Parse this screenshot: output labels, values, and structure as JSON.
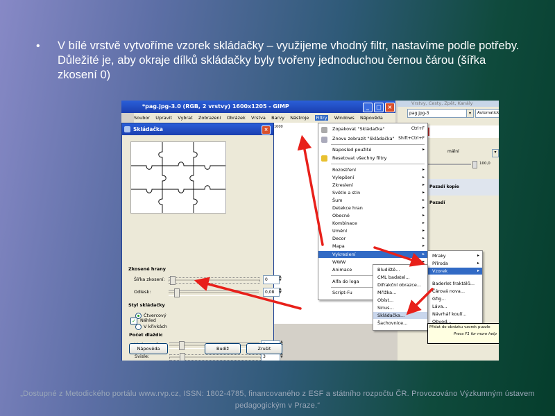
{
  "slide": {
    "bullet": "•",
    "text": "V bílé vrstvě vytvoříme vzorek skládačky – využijeme vhodný filtr, nastavíme podle potřeby. Důležité je, aby okraje dílků skládačky byly tvořeny jednoduchou černou čárou (šířka zkosení 0)",
    "footer": "„Dostupné z Metodického portálu www.rvp.cz, ISSN: 1802-4785, financovaného z ESF a státního rozpočtu ČR. Provozováno Výzkumným ústavem pedagogickým v Praze.“"
  },
  "gimp": {
    "title": "*pag.jpg-3.0 (RGB, 2 vrstvy) 1600x1205 - GIMP",
    "menu": [
      "Soubor",
      "Upravit",
      "Vybrat",
      "Zobrazení",
      "Obrázek",
      "Vrstva",
      "Barvy",
      "Nástroje",
      "Filtry",
      "Windows",
      "Nápověda"
    ],
    "active_menu": "Filtry",
    "ruler": "1000"
  },
  "dock": {
    "title": "Vrstvy, Cesty, Zpět, Kanály",
    "image": "pag.jpg-3",
    "auto": "Automaticky",
    "mode": "mální",
    "opacity": "100,0",
    "layers": [
      {
        "name": "Pozadí kopie"
      },
      {
        "name": "Pozadí"
      }
    ]
  },
  "filters_menu": {
    "items": [
      {
        "label": "Zopakovat \"Skládačka\"",
        "shortcut": "Ctrl+F"
      },
      {
        "label": "Znovu zobrazit \"Skládačka\"",
        "shortcut": "Shift+Ctrl+F"
      },
      {
        "label": "Naposled použité",
        "arrow": true
      },
      {
        "label": "Resetovat všechny filtry"
      },
      {
        "label": "Rozostření",
        "arrow": true
      },
      {
        "label": "Vylepšení",
        "arrow": true
      },
      {
        "label": "Zkreslení",
        "arrow": true
      },
      {
        "label": "Světlo a stín",
        "arrow": true
      },
      {
        "label": "Šum",
        "arrow": true
      },
      {
        "label": "Detekce hran",
        "arrow": true
      },
      {
        "label": "Obecné",
        "arrow": true
      },
      {
        "label": "Kombinace",
        "arrow": true
      },
      {
        "label": "Umění",
        "arrow": true
      },
      {
        "label": "Decor",
        "arrow": true
      },
      {
        "label": "Mapa",
        "arrow": true
      },
      {
        "label": "Vykreslení",
        "arrow": true,
        "highlighted": true
      },
      {
        "label": "WWW",
        "arrow": true
      },
      {
        "label": "Animace",
        "arrow": true
      },
      {
        "label": "Alfa do loga",
        "arrow": true
      },
      {
        "label": "Script-Fu",
        "arrow": true
      }
    ]
  },
  "render_submenu": {
    "items": [
      {
        "label": "Mraky",
        "arrow": true
      },
      {
        "label": "Příroda",
        "arrow": true
      },
      {
        "label": "Vzorek",
        "arrow": true,
        "highlighted": true
      },
      {
        "label": "Baderlet fraktálů..."
      },
      {
        "label": "Čárová nova..."
      },
      {
        "label": "Gfig..."
      },
      {
        "label": "Láva..."
      },
      {
        "label": "Návrhář koulí..."
      },
      {
        "label": "Obvod..."
      }
    ]
  },
  "pattern_submenu": {
    "items": [
      {
        "label": "Bludiště..."
      },
      {
        "label": "CML badatel..."
      },
      {
        "label": "Difrakční obrazce..."
      },
      {
        "label": "Mřížka..."
      },
      {
        "label": "Obíst..."
      },
      {
        "label": "Sinus..."
      },
      {
        "label": "Skládačka...",
        "highlighted": true
      },
      {
        "label": "Šachovnice..."
      }
    ]
  },
  "tooltip": {
    "line1": "Přidat do obrázku vzorek puzzle",
    "line2": "Press F1 for more help"
  },
  "dialog": {
    "title": "Skládačka",
    "preview_label": "Náhled",
    "preview_checked": true,
    "tiles_header": "Počet dlaždic",
    "horizontal_label": "Vodorovně:",
    "horizontal_value": "3",
    "vertical_label": "Svisle:",
    "vertical_value": "3",
    "bevel_header": "Zkosené hrany",
    "bevel_width_label": "Šířka zkosení:",
    "bevel_width_value": "0",
    "highlight_label": "Odlesk:",
    "highlight_value": "0,08",
    "style_header": "Styl skládačky",
    "style_square": "Čtvercový",
    "style_curved": "V křivkách",
    "help_button": "Nápověda",
    "reset_button": "Budiž",
    "ok_button": "Zrušit"
  },
  "colors": {
    "arrow": "#e8201a",
    "highlight": "#316ac5",
    "titlebar": "#2a5fd8"
  }
}
